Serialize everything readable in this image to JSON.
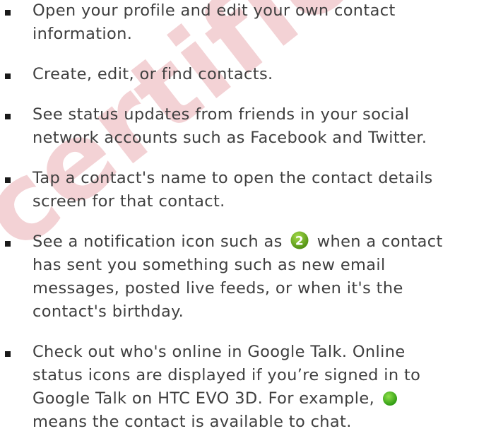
{
  "watermark_text": "certification re",
  "items": [
    {
      "lines": [
        "Open your profile and edit your own contact",
        "information."
      ]
    },
    {
      "lines": [
        "Create, edit, or find contacts."
      ]
    },
    {
      "lines": [
        "See status updates from friends in your social",
        "network accounts such as Facebook and Twitter."
      ]
    },
    {
      "lines": [
        "Tap a contact's name to open the contact details",
        "screen for that contact."
      ]
    },
    {
      "line1_before": "See a notification icon such as",
      "badge_number": "2",
      "line1_after": "when a contact",
      "lines_rest": [
        "has sent you something such as new email",
        "messages, posted live feeds, or when it's the",
        "contact's birthday."
      ]
    },
    {
      "lines_head": [
        "Check out who's online in Google Talk. Online",
        "status icons are displayed if you’re signed in to"
      ],
      "line3_before": "Google Talk on HTC EVO 3D. For example,",
      "line4": "means the contact is available to chat."
    }
  ],
  "colors": {
    "badge_green": "#6fb01e",
    "online_green": "#3fae1c",
    "watermark": "#f3d2d5",
    "text": "#3f3f3f"
  },
  "icons": {
    "badge": "notification-badge-icon",
    "online": "online-status-icon"
  }
}
